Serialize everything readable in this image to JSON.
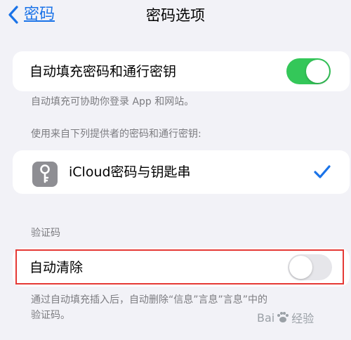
{
  "nav": {
    "back_label": "密码",
    "title": "密码选项"
  },
  "autofill": {
    "label": "自动填充密码和通行密钥",
    "enabled": true,
    "footnote": "自动填充可协助你登录 App 和网站。"
  },
  "providers": {
    "header": "使用来自下列提供者的密码和通行密钥:",
    "items": [
      {
        "label": "iCloud密码与钥匙串",
        "icon": "key-icon",
        "selected": true
      }
    ]
  },
  "verification": {
    "header": "验证码",
    "auto_clean_label": "自动清除",
    "auto_clean_enabled": false,
    "footnote_line1": "通过自动填充插入后，自动删除“信息”言息”言息”中的",
    "footnote_line2": "验证码。"
  },
  "watermark": {
    "text_a": "Bai",
    "text_b": "经验"
  },
  "colors": {
    "accent": "#1a73e8",
    "toggle_on": "#34c759",
    "highlight": "#e53935"
  }
}
